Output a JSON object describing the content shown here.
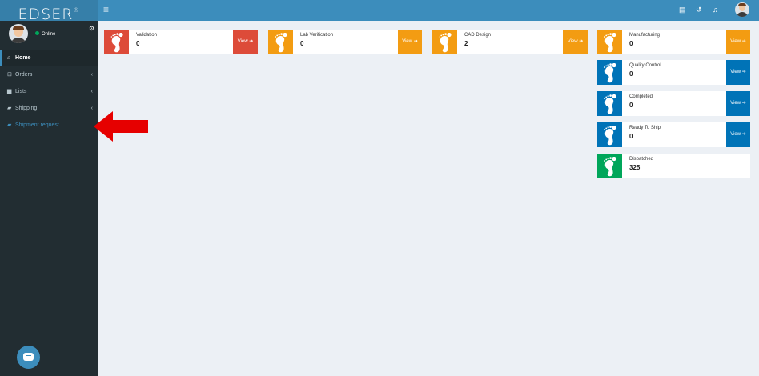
{
  "brand": {
    "name": "EDSER",
    "mark": "®"
  },
  "user": {
    "status": "Online"
  },
  "sidebar": {
    "items": [
      {
        "label": "Home",
        "icon": "home-icon"
      },
      {
        "label": "Orders",
        "icon": "cart-icon"
      },
      {
        "label": "Lists",
        "icon": "file-icon"
      },
      {
        "label": "Shipping",
        "icon": "truck-icon"
      },
      {
        "label": "Shipment request",
        "icon": "truck-icon"
      }
    ]
  },
  "boxes": {
    "validation": {
      "label": "Validation",
      "count": "0",
      "view": "View ➔"
    },
    "lab": {
      "label": "Lab Verification",
      "count": "0",
      "view": "View ➔"
    },
    "cad": {
      "label": "CAD Design",
      "count": "2",
      "view": "View ➔"
    },
    "manufacturing": {
      "label": "Manufacturing",
      "count": "0",
      "view": "View ➔"
    },
    "quality": {
      "label": "Quality Control",
      "count": "0",
      "view": "View ➔"
    },
    "completed": {
      "label": "Completed",
      "count": "0",
      "view": "View ➔"
    },
    "ready": {
      "label": "Ready To Ship",
      "count": "0",
      "view": "View ➔"
    },
    "dispatched": {
      "label": "Dispatched",
      "count": "325"
    }
  },
  "colors": {
    "red": "#dd4b39",
    "orange": "#f39c12",
    "blue": "#0073b7",
    "green": "#00a65a",
    "header": "#3c8dbc",
    "sidebar": "#222d32"
  }
}
